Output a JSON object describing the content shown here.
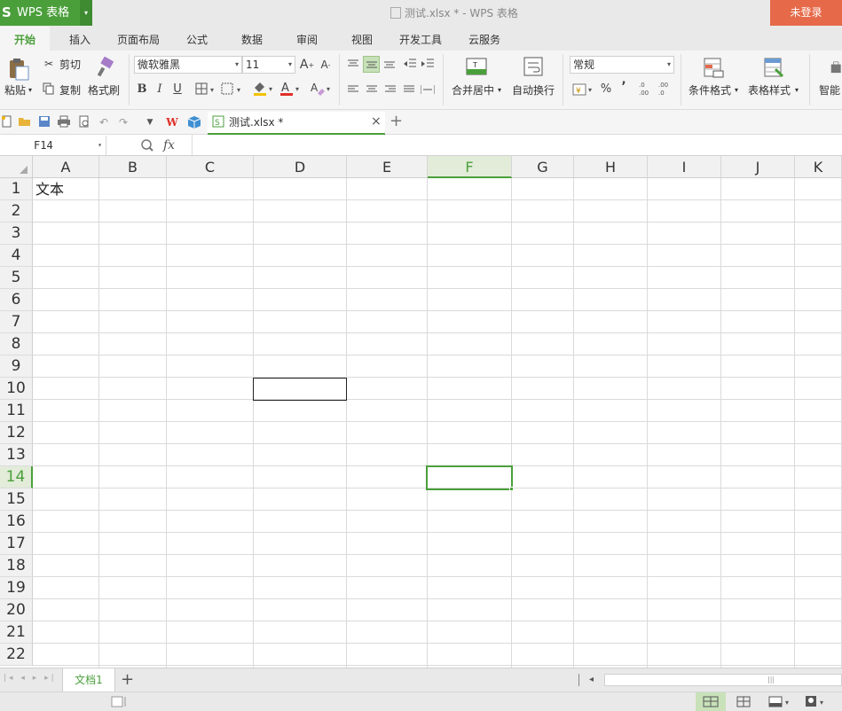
{
  "app": {
    "logo": "S",
    "name": "WPS 表格",
    "dropdown": "▾"
  },
  "window": {
    "title": "测试.xlsx * - WPS 表格",
    "login": "未登录"
  },
  "tabs": [
    "开始",
    "插入",
    "页面布局",
    "公式",
    "数据",
    "审阅",
    "视图",
    "开发工具",
    "云服务"
  ],
  "ribbon": {
    "paste": "粘贴",
    "cut": "剪切",
    "copy": "复制",
    "format_painter": "格式刷",
    "font_name": "微软雅黑",
    "font_size": "11",
    "bold": "B",
    "italic": "I",
    "underline": "U",
    "merge_center": "合并居中",
    "wrap_text": "自动换行",
    "number_format": "常规",
    "percent": "%",
    "comma": "’",
    "conditional_format": "条件格式",
    "table_style": "表格样式",
    "smart": "智能"
  },
  "file_tab": {
    "name": "测试.xlsx *",
    "close": "×",
    "add": "+"
  },
  "formula_bar": {
    "name_box": "F14",
    "fx": "fx"
  },
  "columns": [
    "A",
    "B",
    "C",
    "D",
    "E",
    "F",
    "G",
    "H",
    "I",
    "J",
    "K"
  ],
  "rows": [
    "1",
    "2",
    "3",
    "4",
    "5",
    "6",
    "7",
    "8",
    "9",
    "10",
    "11",
    "12",
    "13",
    "14",
    "15",
    "16",
    "17",
    "18",
    "19",
    "20",
    "21",
    "22"
  ],
  "selected": {
    "cell": "F14",
    "column": "F",
    "row": "14"
  },
  "cells": {
    "A1": "文本"
  },
  "sheets": {
    "name": "文档1",
    "add": "+"
  },
  "colors": {
    "accent": "#4b9f3b",
    "login_bg": "#e66a4a"
  }
}
